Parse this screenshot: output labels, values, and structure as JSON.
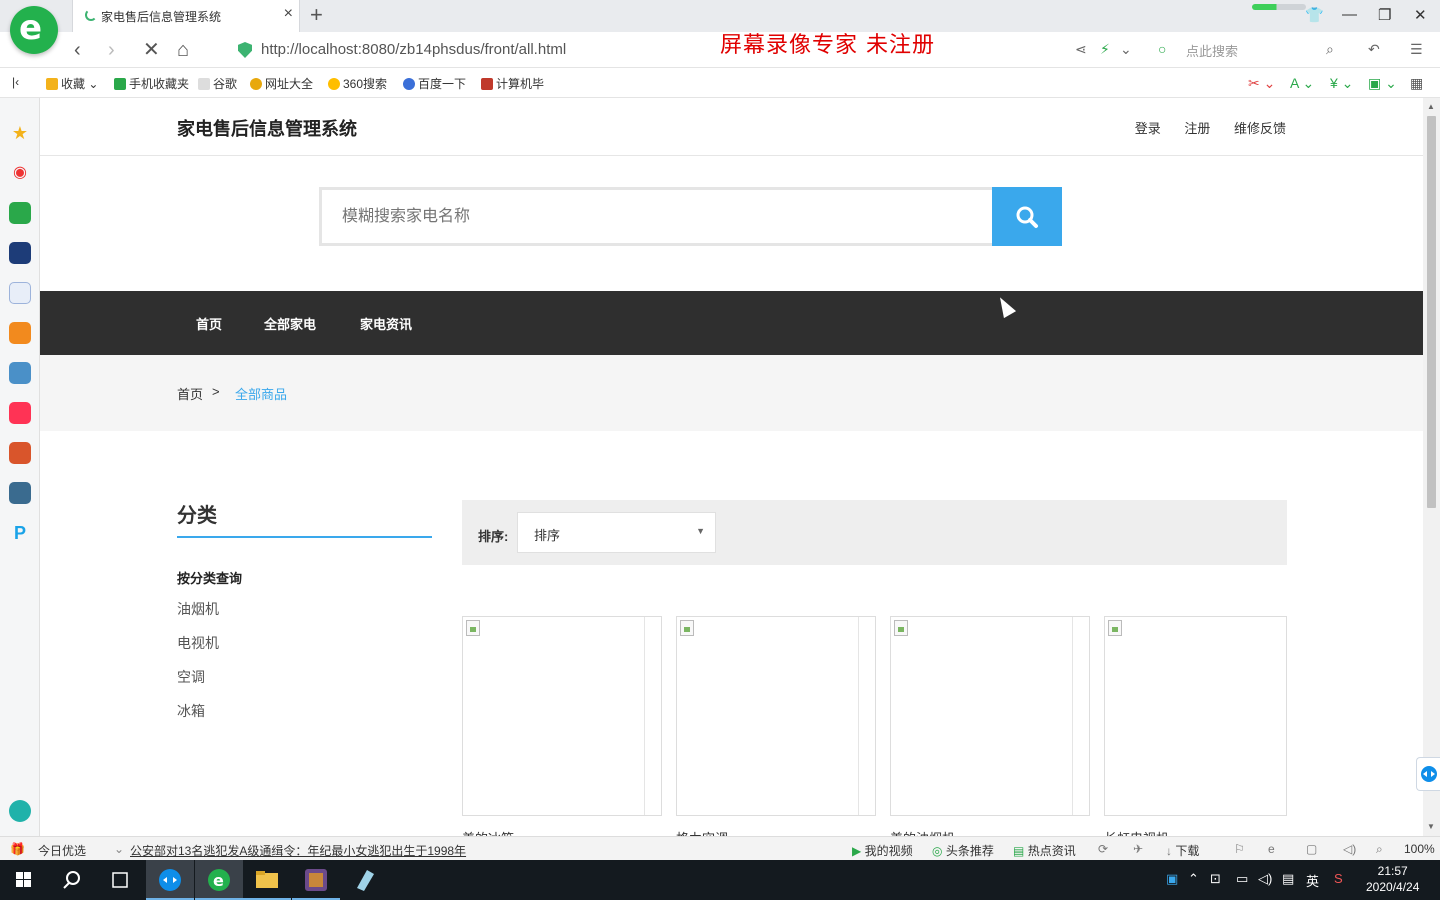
{
  "browser": {
    "tab_title": "家电售后信息管理系统",
    "new_tab": "+",
    "close": "×",
    "url": "http://localhost:8080/zb14phsdus/front/all.html",
    "recorder_watermark": "屏幕录像专家  未注册",
    "search_placeholder": "点此搜索",
    "window_controls": [
      "—",
      "❐",
      "✕"
    ]
  },
  "bookmarks": [
    {
      "label": "收藏",
      "color": "#f3b21b"
    },
    {
      "label": "手机收藏夹",
      "color": "#2aa84a"
    },
    {
      "label": "谷歌",
      "color": "#bbbbbb"
    },
    {
      "label": "网址大全",
      "color": "#e8a80c"
    },
    {
      "label": "360搜索",
      "color": "#ffbe00"
    },
    {
      "label": "百度一下",
      "color": "#3b6fd8"
    },
    {
      "label": "计算机毕",
      "color": "#c0392b"
    }
  ],
  "site": {
    "title": "家电售后信息管理系统",
    "top_links": [
      "登录",
      "注册",
      "维修反馈"
    ],
    "search_placeholder": "模糊搜索家电名称",
    "nav": [
      "首页",
      "全部家电",
      "家电资讯"
    ],
    "breadcrumb": {
      "home": "首页",
      "sep": ">",
      "current": "全部商品"
    },
    "category": {
      "title": "分类",
      "heading": "按分类查询",
      "items": [
        "油烟机",
        "电视机",
        "空调",
        "冰箱"
      ]
    },
    "sort": {
      "label": "排序:",
      "value": "排序"
    },
    "products": [
      {
        "name": "美的冰箱"
      },
      {
        "name": "格力空调"
      },
      {
        "name": "美的油烟机"
      },
      {
        "name": "长虹电视机"
      }
    ]
  },
  "statusbar": {
    "left": "今日优选",
    "news": "公安部对13名逃犯发A级通缉令：年纪最小女逃犯出生于1998年",
    "items": [
      "我的视频",
      "头条推荐",
      "热点资讯",
      "下载"
    ],
    "zoom": "100%"
  },
  "taskbar": {
    "time": "21:57",
    "date": "2020/4/24",
    "ime": "英"
  },
  "colors": {
    "accent": "#3aa8ec",
    "nav_bg": "#2f2f2f",
    "breadcrumb_link": "#3aa8ec",
    "recorder_red": "#e00000"
  }
}
